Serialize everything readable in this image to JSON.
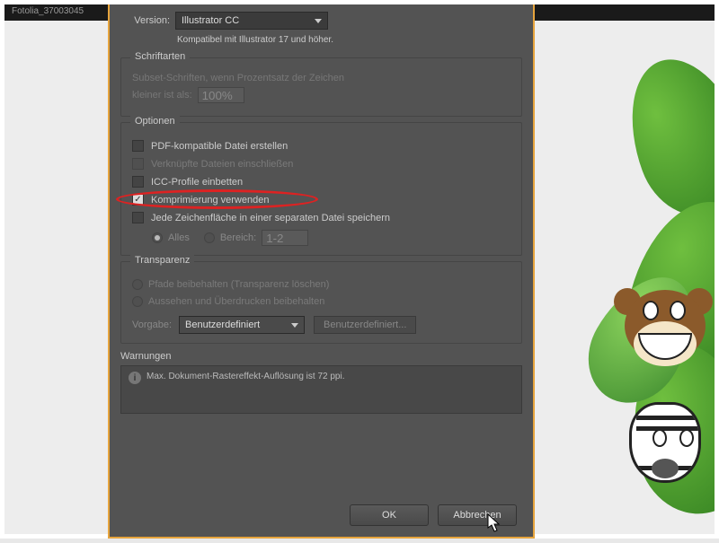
{
  "tab_title": "Fotolia_37003045",
  "version": {
    "label": "Version:",
    "selected": "Illustrator CC",
    "compat_note": "Kompatibel mit Illustrator 17 und höher."
  },
  "fonts": {
    "group_title": "Schriftarten",
    "subset_line1": "Subset-Schriften, wenn Prozentsatz der Zeichen",
    "subset_line2": "kleiner ist als:",
    "percent_value": "100%"
  },
  "options": {
    "group_title": "Optionen",
    "pdf_compat": "PDF-kompatible Datei erstellen",
    "linked_files": "Verknüpfte Dateien einschließen",
    "icc": "ICC-Profile einbetten",
    "compression": "Komprimierung verwenden",
    "separate_artboards": "Jede Zeichenfläche in einer separaten Datei speichern",
    "range_all": "Alles",
    "range_range": "Bereich:",
    "range_value": "1-2"
  },
  "transparency": {
    "group_title": "Transparenz",
    "keep_paths": "Pfade beibehalten (Transparenz löschen)",
    "keep_appearance": "Aussehen und Überdrucken beibehalten",
    "preset_label": "Vorgabe:",
    "preset_selected": "Benutzerdefiniert",
    "custom_btn": "Benutzerdefiniert..."
  },
  "warnings": {
    "title": "Warnungen",
    "text": "Max. Dokument-Rastereffekt-Auflösung ist 72 ppi."
  },
  "buttons": {
    "ok": "OK",
    "cancel": "Abbrechen"
  }
}
